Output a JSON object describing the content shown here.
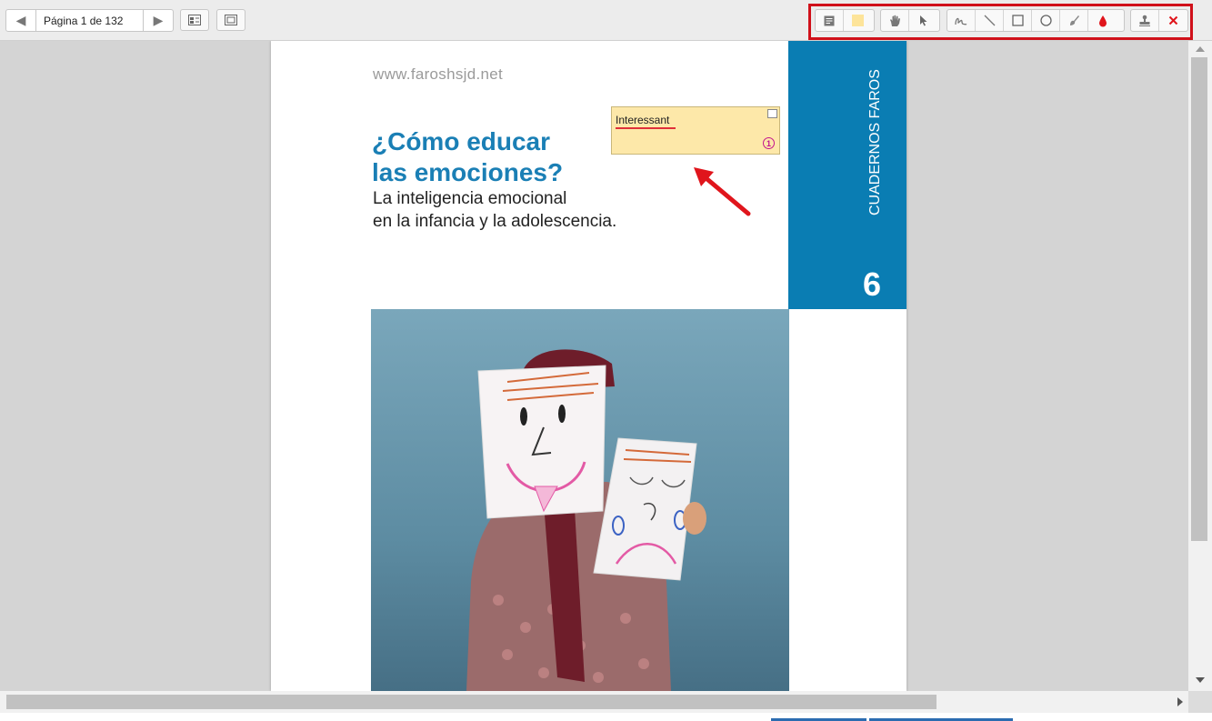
{
  "toolbar": {
    "page_label": "Página 1 de 132",
    "prev_icon": "◀",
    "next_icon": "▶"
  },
  "document": {
    "url": "www.faroshsjd.net",
    "title_line1": "¿Cómo educar",
    "title_line2": "las emociones?",
    "subtitle_line1": "La inteligencia emocional",
    "subtitle_line2": "en la infancia y la adolescencia.",
    "series": "CUADERNOS FAROS",
    "number": "6"
  },
  "annotation": {
    "text": "Interessant",
    "count": "1"
  },
  "colors": {
    "brand_blue": "#0a7db3",
    "highlight_frame": "#d0101a",
    "note_bg": "#fde8a9",
    "arrow": "#e0151c"
  },
  "icons": [
    "prev-page-icon",
    "next-page-icon",
    "thumbnails-icon",
    "fit-page-icon",
    "note-icon",
    "highlight-icon",
    "hand-icon",
    "pointer-icon",
    "freehand-icon",
    "line-icon",
    "rectangle-icon",
    "circle-icon",
    "ink-icon",
    "color-icon",
    "stamp-icon",
    "delete-icon"
  ]
}
